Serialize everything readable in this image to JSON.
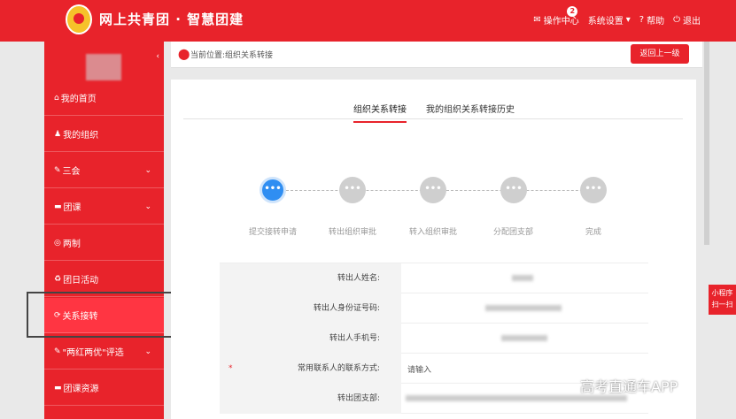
{
  "header": {
    "title": "网上共青团 · 智慧团建",
    "nav": [
      {
        "label": "操作中心",
        "icon": "envelope-icon",
        "badge": "2"
      },
      {
        "label": "系统设置",
        "icon": "gear-icon",
        "chevron": "▾"
      },
      {
        "label": "帮助",
        "icon": "help-icon"
      },
      {
        "label": "退出",
        "icon": "power-icon"
      }
    ]
  },
  "sidebar": {
    "collapse": "‹",
    "items": [
      {
        "label": "我的首页",
        "icon": "home-icon"
      },
      {
        "label": "我的组织",
        "icon": "users-icon"
      },
      {
        "label": "三会",
        "icon": "edit-icon",
        "chevron": "⌄"
      },
      {
        "label": "团课",
        "icon": "folder-icon",
        "chevron": "⌄"
      },
      {
        "label": "两制",
        "icon": "target-icon"
      },
      {
        "label": "团日活动",
        "icon": "recycle-icon"
      },
      {
        "label": "关系接转",
        "icon": "refresh-icon"
      },
      {
        "label": "\"两红两优\"评选",
        "icon": "edit-icon",
        "chevron": "⌄"
      },
      {
        "label": "团课资源",
        "icon": "folder-icon"
      }
    ]
  },
  "breadcrumb": {
    "text": "当前位置:组织关系转接",
    "back": "返回上一级"
  },
  "tabs": [
    {
      "label": "组织关系转接"
    },
    {
      "label": "我的组织关系转接历史"
    }
  ],
  "steps": [
    {
      "label": "提交接转申请",
      "dot": "•••"
    },
    {
      "label": "转出组织审批",
      "dot": "•••"
    },
    {
      "label": "转入组织审批",
      "dot": "•••"
    },
    {
      "label": "分配团支部",
      "dot": "•••"
    },
    {
      "label": "完成",
      "dot": "•••"
    }
  ],
  "form": [
    {
      "label": "转出人姓名:",
      "value": ""
    },
    {
      "label": "转出人身份证号码:",
      "value": ""
    },
    {
      "label": "转出人手机号:",
      "value": ""
    },
    {
      "label": "常用联系人的联系方式:",
      "value": "请输入",
      "required": "*"
    },
    {
      "label": "转出团支部:",
      "value": ""
    }
  ],
  "mini_program": {
    "line1": "小程序",
    "line2": "扫一扫"
  },
  "watermark": "高考直通车APP",
  "colors": {
    "primary": "#e8232b",
    "active_step": "#2f8ef2"
  }
}
